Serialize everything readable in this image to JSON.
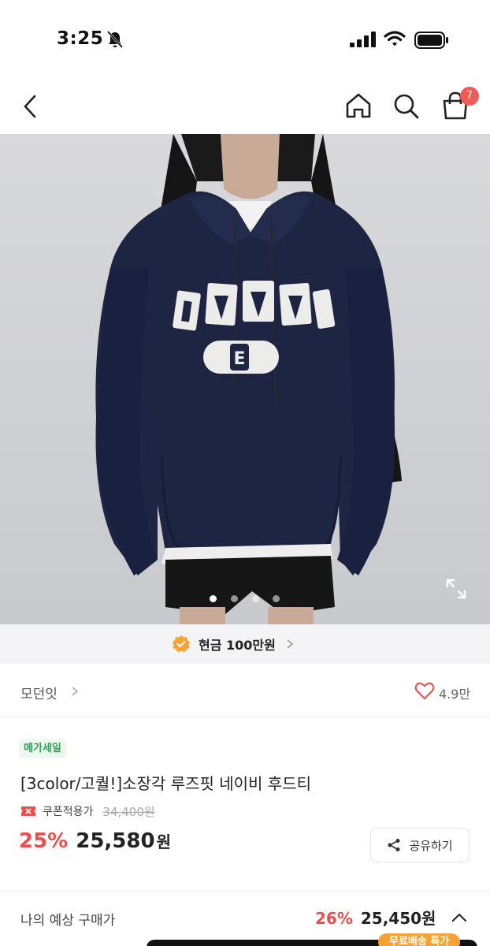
{
  "status_bar": {
    "time": "3:25"
  },
  "header": {
    "cart_count": "7"
  },
  "gallery": {
    "slide_count": 4,
    "active_slide": 1
  },
  "benefit": {
    "text": "현금 100만원"
  },
  "brand": {
    "name": "모던잇",
    "likes": "4.9만"
  },
  "product": {
    "badge": "메가세일",
    "title": "[3color/고퀄!]소장각 루즈핏 네이비 후드티",
    "coupon_label": "쿠폰적용가",
    "original_price": "34,400원",
    "discount": "25%",
    "price": "25,580",
    "price_unit": "원",
    "share_label": "공유하기"
  },
  "expected": {
    "label": "나의 예상 구매가",
    "discount": "26%",
    "price": "25,450원"
  },
  "bottom": {
    "free_shipping": "무료배송 특가"
  },
  "colors": {
    "accent_red": "#ef4c4c",
    "badge_green": "#2aa451",
    "benefit_orange": "#f7a233"
  },
  "icons": [
    "bell-off-icon",
    "signal-icon",
    "wifi-icon",
    "battery-icon",
    "back-icon",
    "home-icon",
    "search-icon",
    "cart-icon",
    "expand-icon",
    "verified-icon",
    "chevron-right-icon",
    "heart-icon",
    "coupon-icon",
    "share-icon",
    "chevron-up-icon"
  ]
}
